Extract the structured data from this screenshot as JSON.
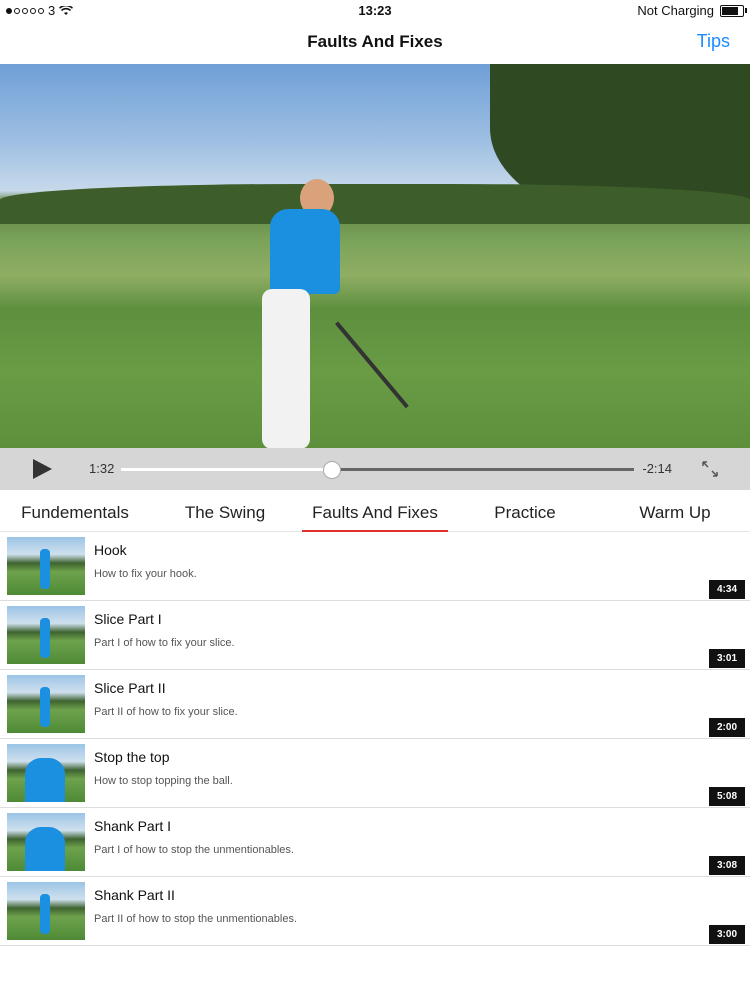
{
  "status": {
    "carrier": "3",
    "time": "13:23",
    "battery_text": "Not Charging",
    "battery_level": 0.9
  },
  "nav": {
    "title": "Faults And Fixes",
    "tips": "Tips"
  },
  "player": {
    "elapsed": "1:32",
    "remaining": "-2:14",
    "progress": 0.41
  },
  "tabs": [
    {
      "label": "Fundementals"
    },
    {
      "label": "The Swing"
    },
    {
      "label": "Faults And Fixes",
      "active": true
    },
    {
      "label": "Practice"
    },
    {
      "label": "Warm Up"
    }
  ],
  "videos": [
    {
      "title": "Hook",
      "desc": "How to fix your hook.",
      "duration": "4:34"
    },
    {
      "title": "Slice Part I",
      "desc": "Part I of how to fix your slice.",
      "duration": "3:01"
    },
    {
      "title": "Slice Part II",
      "desc": "Part II of how to fix your slice.",
      "duration": "2:00"
    },
    {
      "title": "Stop the top",
      "desc": "How to stop topping the ball.",
      "duration": "5:08"
    },
    {
      "title": "Shank Part I",
      "desc": "Part I of how to stop the unmentionables.",
      "duration": "3:08"
    },
    {
      "title": "Shank Part II",
      "desc": "Part II of how to stop the unmentionables.",
      "duration": "3:00"
    }
  ],
  "colors": {
    "accent": "#1a8cff",
    "tab_indicator": "#e03030"
  }
}
